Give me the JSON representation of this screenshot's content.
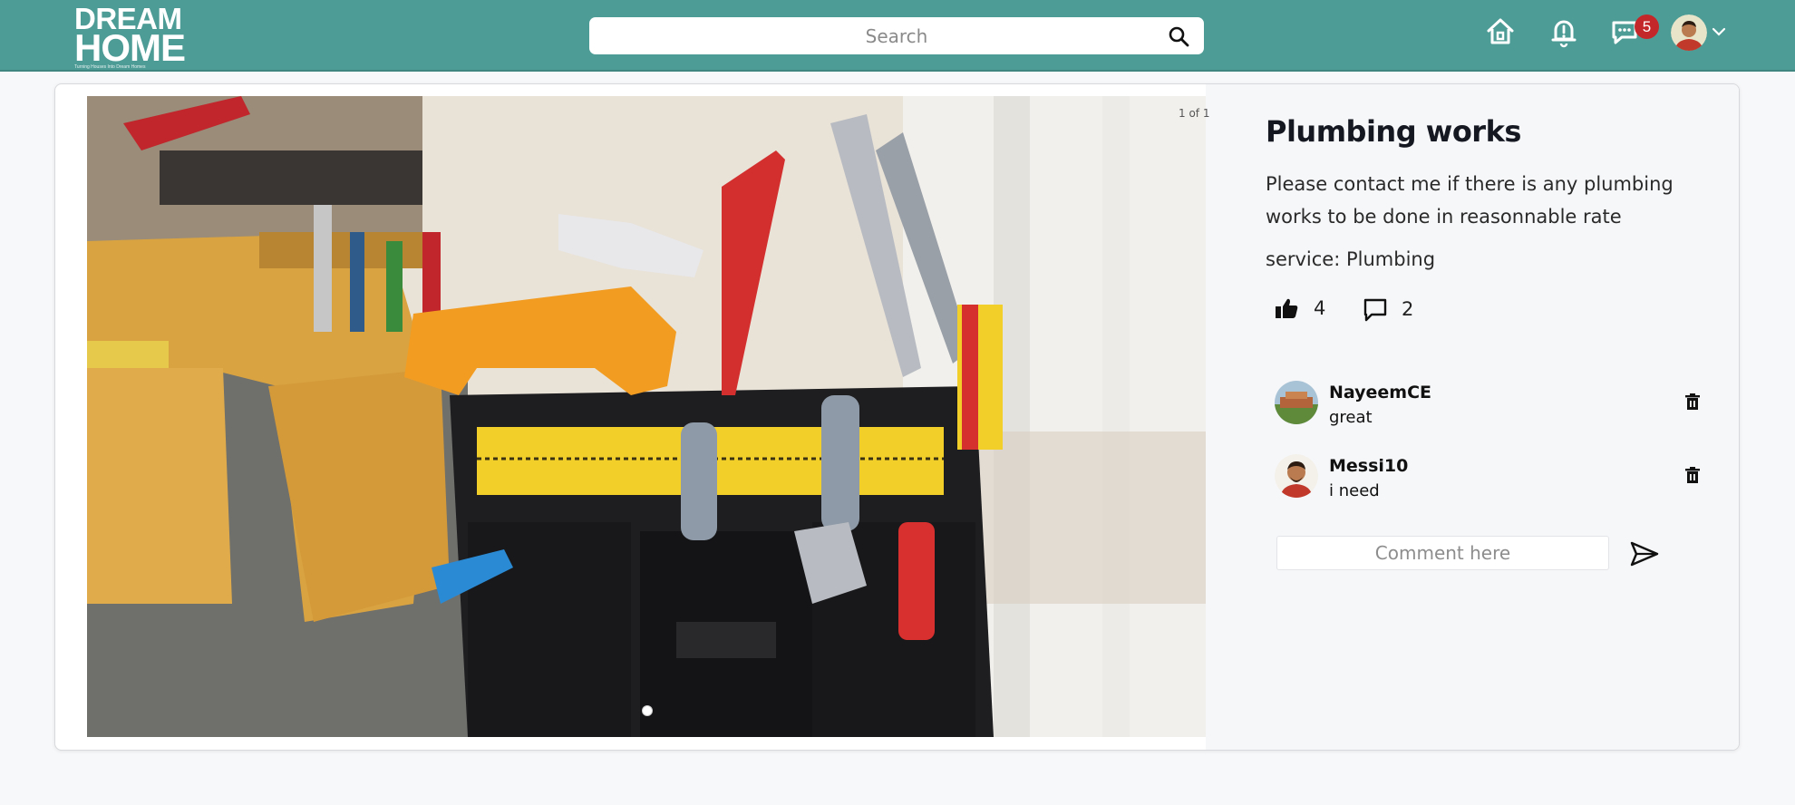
{
  "app": {
    "logo_line1": "DREAM",
    "logo_line2": "HOME",
    "logo_tagline": "Turning Houses Into Dream Homes"
  },
  "header": {
    "search_placeholder": "Search",
    "notification_badge": "5",
    "icons": [
      "home-icon",
      "bell-icon",
      "chat-icon",
      "search-icon",
      "chevron-down-icon"
    ],
    "brand_color": "#4e9c96",
    "badge_color": "#c4272a"
  },
  "post": {
    "image_counter": "1 of 1",
    "title": "Plumbing works",
    "description": "Please contact me if there is any plumbing works to be done in reasonnable rate",
    "service_label": "service: ",
    "service_value": "Plumbing",
    "likes": "4",
    "comments_count": "2"
  },
  "comments": [
    {
      "author": "NayeemCE",
      "text": "great"
    },
    {
      "author": "Messi10",
      "text": "i need"
    }
  ],
  "comment_box": {
    "placeholder": "Comment here"
  }
}
